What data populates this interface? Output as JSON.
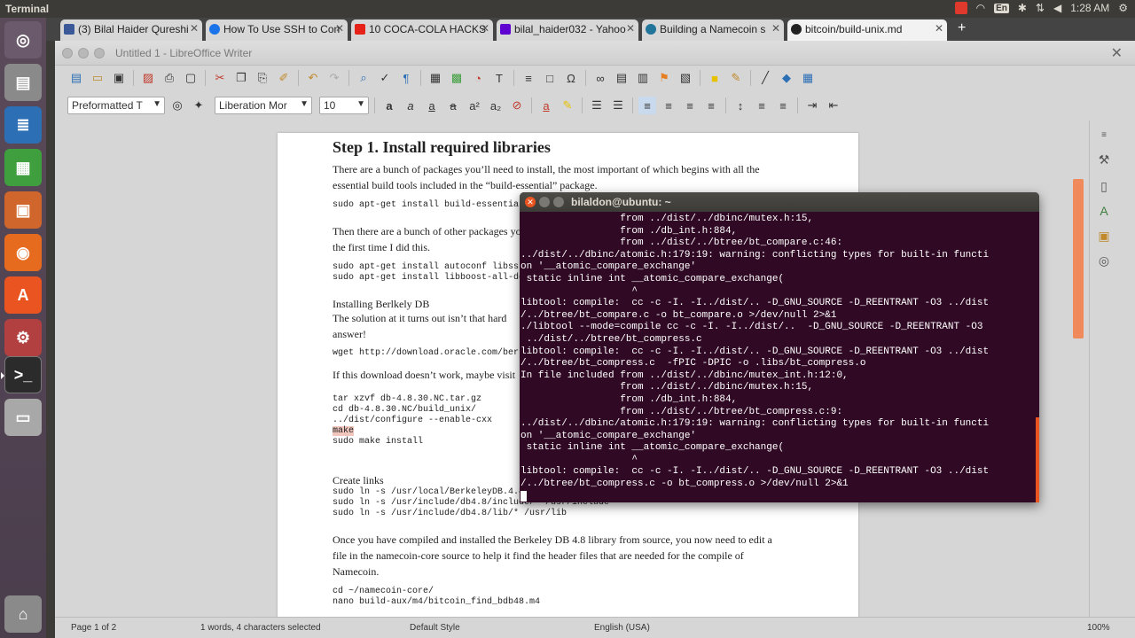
{
  "top_panel": {
    "title": "Terminal",
    "lang": "En",
    "clock": "1:28 AM"
  },
  "browser": {
    "tabs": [
      {
        "label": "(3) Bilal Haider Qureshi",
        "icon_color": "#3b5998"
      },
      {
        "label": "How To Use SSH to Con",
        "icon_color": "#1a73e8"
      },
      {
        "label": "10 COCA-COLA HACKS",
        "icon_color": "#e62117"
      },
      {
        "label": "bilal_haider032 - Yahoo",
        "icon_color": "#5f01d1"
      },
      {
        "label": "Building a Namecoin s",
        "icon_color": "#21759b"
      },
      {
        "label": "bitcoin/build-unix.md",
        "icon_color": "#222222"
      }
    ],
    "new_tab": "+"
  },
  "writer": {
    "title": "Untitled 1 - LibreOffice Writer",
    "style_combo": "Preformatted T",
    "font_combo": "Liberation Mor",
    "size_combo": "10"
  },
  "document": {
    "heading": "Step 1. Install required libraries",
    "para1_l1": "There are a bunch of packages you’ll need to install, the most important of which begins with all the",
    "para1_l2": "essential build tools included in the “build-essential” package.",
    "code1": "sudo apt-get install build-essential",
    "para2_l1": "Then there are a bunch of other packages you’ll need to install, I also found I needed",
    "para2_l2": "the first time I did this.",
    "code2_l1": "sudo apt-get install autoconf libssl-dev",
    "code2_l2": "sudo apt-get install libboost-all-dev",
    "section1": "Installing Berlkely DB",
    "para3_l1": "The solution at it turns out isn’t that hard",
    "para3_l2": "answer!",
    "code3": "wget http://download.oracle.com/berkeley-db/db-4.8.30.NC.tar.gz",
    "para4": "If this download doesn’t work, maybe visit",
    "code4_l1": "tar xzvf db-4.8.30.NC.tar.gz",
    "code4_l2": "cd db-4.8.30.NC/build_unix/",
    "code4_l3": "../dist/configure --enable-cxx",
    "code4_l4": "make",
    "code4_l5": "sudo make install",
    "section2": "Create links",
    "code5_l1": "sudo ln -s /usr/local/BerkeleyDB.4.8 /usr/local/db4.8",
    "code5_l2": "sudo ln -s /usr/include/db4.8/include/* /usr/include",
    "code5_l3": "sudo ln -s /usr/include/db4.8/lib/* /usr/lib",
    "para5_l1": "Once you have compiled and installed the Berkeley DB 4.8 library from source, you now need to edit a",
    "para5_l2": "file in the namecoin-core source to help it find the header files that are needed for the compile of",
    "para5_l3": "Namecoin.",
    "code6_l1": "cd ~/namecoin-core/",
    "code6_l2": "nano build-aux/m4/bitcoin_find_bdb48.m4"
  },
  "status": {
    "page": "Page 1 of 2",
    "words": "1 words, 4 characters selected",
    "style": "Default Style",
    "language": "English (USA)",
    "zoom": "100%"
  },
  "terminal": {
    "title": "bilaldon@ubuntu: ~",
    "lines": [
      "                 from ../dist/../dbinc/mutex.h:15,",
      "                 from ./db_int.h:884,",
      "                 from ../dist/../btree/bt_compare.c:46:",
      "../dist/../dbinc/atomic.h:179:19: warning: conflicting types for built-in functi",
      "on '__atomic_compare_exchange'",
      " static inline int __atomic_compare_exchange(",
      "                   ^",
      "libtool: compile:  cc -c -I. -I../dist/.. -D_GNU_SOURCE -D_REENTRANT -O3 ../dist",
      "/../btree/bt_compare.c -o bt_compare.o >/dev/null 2>&1",
      "./libtool --mode=compile cc -c -I. -I../dist/..  -D_GNU_SOURCE -D_REENTRANT -O3",
      " ../dist/../btree/bt_compress.c",
      "libtool: compile:  cc -c -I. -I../dist/.. -D_GNU_SOURCE -D_REENTRANT -O3 ../dist",
      "/../btree/bt_compress.c  -fPIC -DPIC -o .libs/bt_compress.o",
      "In file included from ../dist/../dbinc/mutex_int.h:12:0,",
      "                 from ../dist/../dbinc/mutex.h:15,",
      "                 from ./db_int.h:884,",
      "                 from ../dist/../btree/bt_compress.c:9:",
      "../dist/../dbinc/atomic.h:179:19: warning: conflicting types for built-in functi",
      "on '__atomic_compare_exchange'",
      " static inline int __atomic_compare_exchange(",
      "                   ^",
      "libtool: compile:  cc -c -I. -I../dist/.. -D_GNU_SOURCE -D_REENTRANT -O3 ../dist",
      "/../btree/bt_compress.c -o bt_compress.o >/dev/null 2>&1"
    ]
  }
}
